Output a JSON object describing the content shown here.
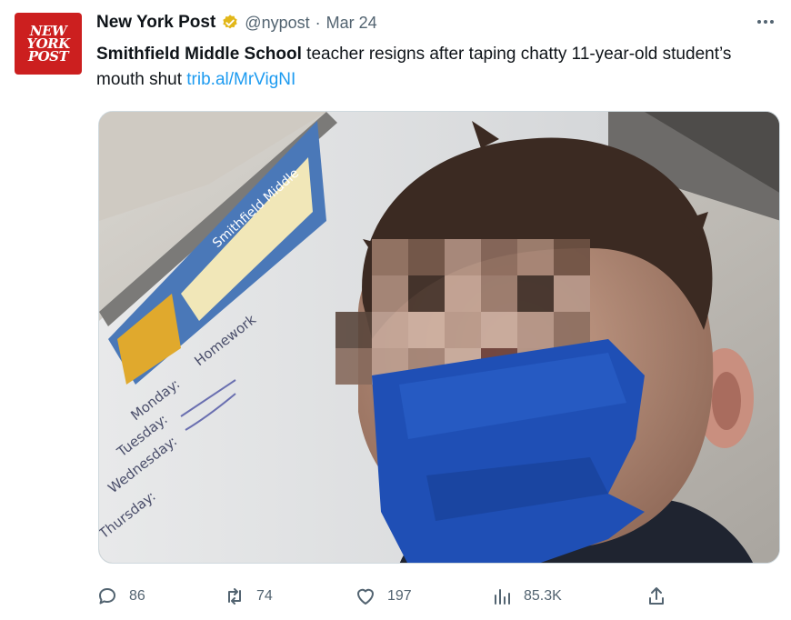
{
  "tweet": {
    "avatar": {
      "logo_lines": [
        "NEW",
        "YORK",
        "POST"
      ],
      "bg_color": "#cc1f1f"
    },
    "author": {
      "display_name": "New York Post",
      "handle": "@nypost",
      "separator": "·",
      "date": "Mar 24",
      "verified_color": "#e2b719"
    },
    "text": {
      "bold_part": "Smithfield Middle School",
      "rest": " teacher resigns after taping chatty 11-year-old student’s mouth shut ",
      "link": "trib.al/MrVigNI",
      "link_color": "#1d9bf0"
    },
    "media": {
      "board_text": [
        "Homework",
        "Monday:",
        "Tuesday:",
        "Wednesday:",
        "Thursday:"
      ],
      "poster_text": "Smithfield Middle",
      "tape_color": "#1f4fb5"
    },
    "actions": {
      "replies": "86",
      "retweets": "74",
      "likes": "197",
      "views": "85.3K"
    }
  }
}
